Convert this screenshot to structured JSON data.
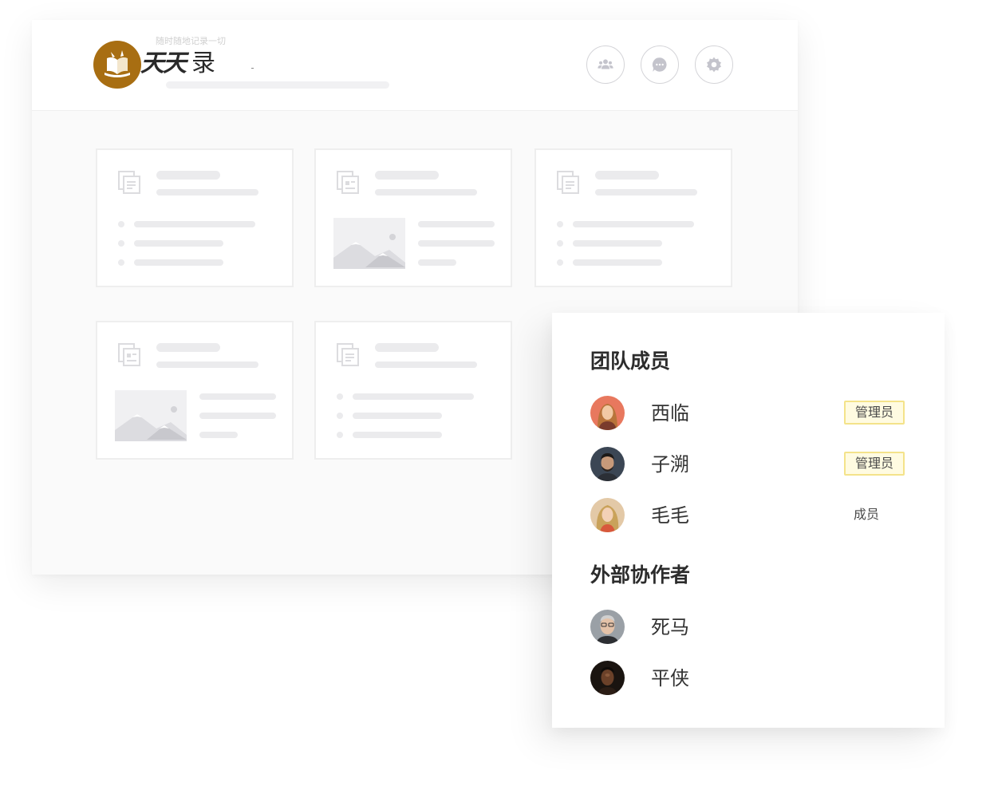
{
  "header": {
    "logo_bold": "天天",
    "logo_light": "录",
    "faint_caption": "随时随地记录一切",
    "buttons": [
      {
        "name": "members-button",
        "icon": "team-icon"
      },
      {
        "name": "messages-button",
        "icon": "chat-icon"
      },
      {
        "name": "settings-button",
        "icon": "gear-icon"
      }
    ]
  },
  "team_panel": {
    "members_title": "团队成员",
    "members": [
      {
        "name": "西临",
        "role": "管理员",
        "role_style": "badge",
        "avatar_color": "#e8785e"
      },
      {
        "name": "子溯",
        "role": "管理员",
        "role_style": "badge",
        "avatar_color": "#3b4654"
      },
      {
        "name": "毛毛",
        "role": "成员",
        "role_style": "plain",
        "avatar_color": "#e3c9a7"
      }
    ],
    "collaborators_title": "外部协作者",
    "collaborators": [
      {
        "name": "死马",
        "avatar_color": "#9aa0a6"
      },
      {
        "name": "平侠",
        "avatar_color": "#2a1a12"
      }
    ]
  },
  "colors": {
    "brand": "#a86e12",
    "badge_border": "#f4e38a",
    "badge_fill": "#fffbe1",
    "placeholder": "#ebebed"
  }
}
